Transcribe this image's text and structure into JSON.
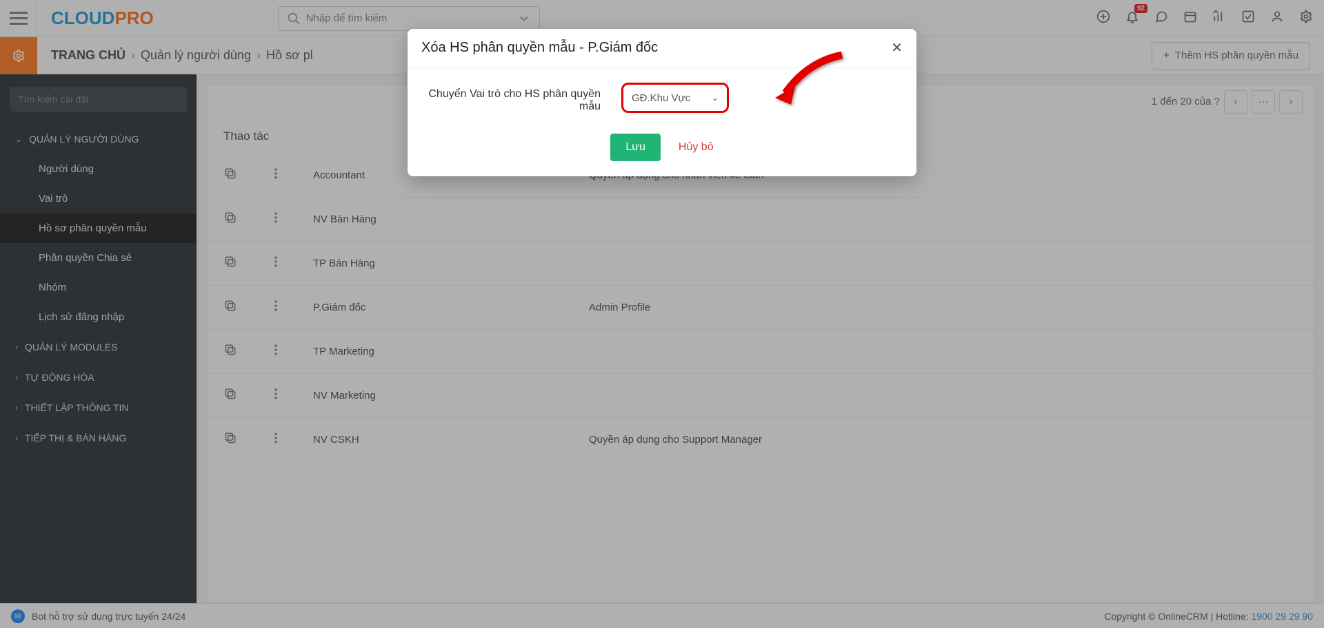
{
  "topbar": {
    "logo_cloud": "CLOUD",
    "logo_pro": "PRO",
    "search_placeholder": "Nhập để tìm kiếm",
    "notif_badge": "92"
  },
  "subbar": {
    "home": "TRANG CHỦ",
    "crumb1": "Quản lý người dùng",
    "crumb2": "Hồ sơ pl",
    "add_label": "Thêm HS phân quyền mẫu"
  },
  "sidebar": {
    "search_placeholder": "Tìm kiếm cài đặt",
    "sec_user": "QUẢN LÝ NGƯỜI DÙNG",
    "sec_modules": "QUẢN LÝ MODULES",
    "sec_auto": "TỰ ĐỘNG HÓA",
    "sec_info": "THIẾT LẬP THÔNG TIN",
    "sec_marketing": "TIẾP THỊ & BÁN HÀNG",
    "items": {
      "0": "Người dùng",
      "1": "Vai trò",
      "2": "Hồ sơ phân quyền mẫu",
      "3": "Phân quyền Chia sẻ",
      "4": "Nhóm",
      "5": "Lịch sử đăng nhập"
    }
  },
  "main": {
    "pagination": "1 đến 20 của  ?",
    "header": "Thao tác",
    "rows": [
      {
        "name": "Accountant",
        "desc": "Quyền áp dụng cho nhân viên kế toán"
      },
      {
        "name": "NV Bán Hàng",
        "desc": ""
      },
      {
        "name": "TP Bán Hàng",
        "desc": ""
      },
      {
        "name": "P.Giám đốc",
        "desc": "Admin Profile"
      },
      {
        "name": "TP Marketing",
        "desc": ""
      },
      {
        "name": "NV Marketing",
        "desc": ""
      },
      {
        "name": "NV CSKH",
        "desc": "Quyền áp dụng cho Support Manager"
      }
    ]
  },
  "modal": {
    "title": "Xóa HS phân quyền mẫu - P.Giám đốc",
    "field_label": "Chuyển Vai trò cho HS phân quyền mẫu",
    "select_value": "GĐ.Khu Vực",
    "save": "Lưu",
    "cancel": "Hủy bỏ"
  },
  "footer": {
    "bot": "Bot hỗ trợ sử dụng trực tuyến 24/24",
    "copyright": "Copyright © OnlineCRM | Hotline: ",
    "phone": "1900 29 29 90"
  }
}
